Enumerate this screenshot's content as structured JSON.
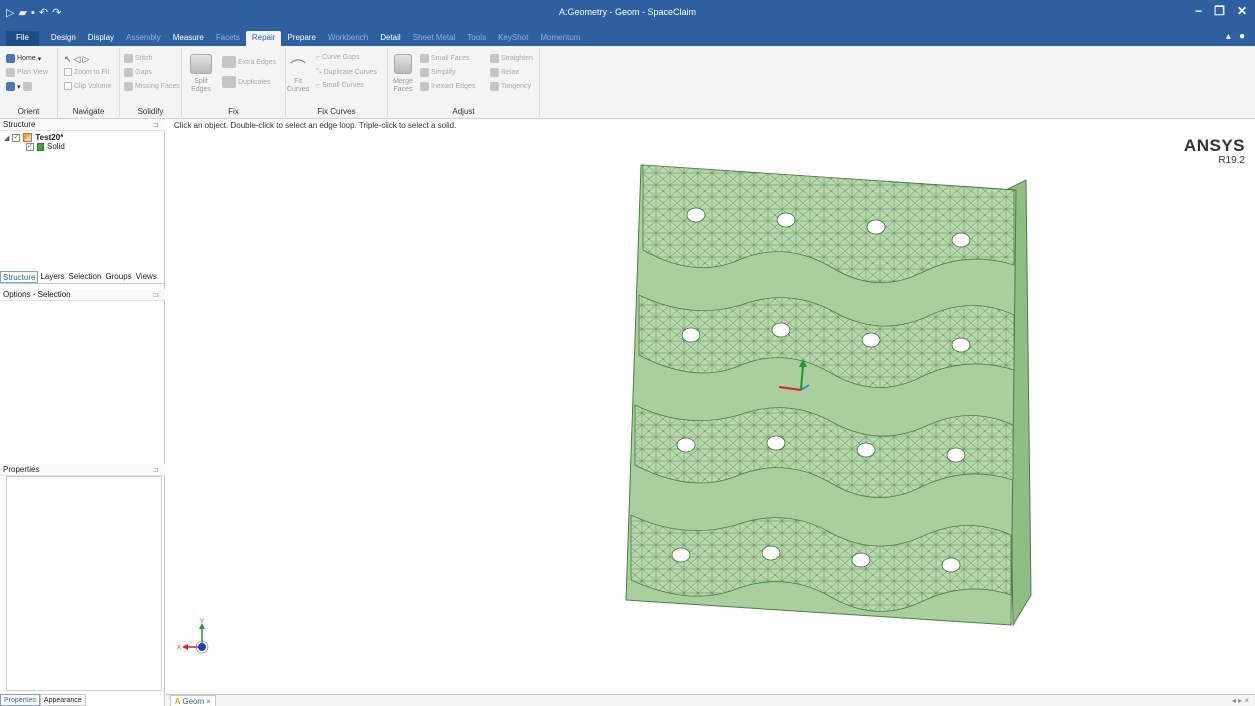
{
  "titlebar": {
    "title": "A:Geometry - Geom - SpaceClaim",
    "quick_access_icons": [
      "play-icon",
      "open-folder-icon",
      "save-icon",
      "undo-icon",
      "redo-icon"
    ],
    "window_controls": [
      "−",
      "❐",
      "✕"
    ]
  },
  "tabs": [
    {
      "label": "File",
      "style": "file"
    },
    {
      "label": "Design",
      "style": "normal"
    },
    {
      "label": "Display",
      "style": "normal"
    },
    {
      "label": "Assembly",
      "style": "dim"
    },
    {
      "label": "Measure",
      "style": "normal"
    },
    {
      "label": "Facets",
      "style": "dim"
    },
    {
      "label": "Repair",
      "style": "active"
    },
    {
      "label": "Prepare",
      "style": "normal"
    },
    {
      "label": "Workbench",
      "style": "dim"
    },
    {
      "label": "Detail",
      "style": "normal"
    },
    {
      "label": "Sheet Metal",
      "style": "dim"
    },
    {
      "label": "Tools",
      "style": "dim"
    },
    {
      "label": "KeyShot",
      "style": "dim"
    },
    {
      "label": "Momentum",
      "style": "dim"
    }
  ],
  "ribbon": {
    "orient": {
      "label": "Orient",
      "home": "Home",
      "plan_view": "Plan View"
    },
    "navigate": {
      "label": "Navigate",
      "zoom_to_fit": "Zoom to Fit",
      "clip_volume": "Clip Volume"
    },
    "solidify": {
      "label": "Solidify",
      "stitch": "Stitch",
      "gaps": "Gaps",
      "missing_faces": "Missing Faces"
    },
    "fix": {
      "label": "Fix",
      "split_edges": "Split Edges",
      "extra_edges": "Extra Edges",
      "duplicates": "Duplicates"
    },
    "fix_curves": {
      "label": "Fix Curves",
      "fit_curves": "Fit Curves",
      "curve_gaps": "Curve Gaps",
      "duplicate_curves": "Duplicate Curves",
      "small_curves": "Small Curves"
    },
    "adjust": {
      "label": "Adjust",
      "merge_faces": "Merge Faces",
      "small_faces": "Small Faces",
      "simplify": "Simplify",
      "inexact_edges": "Inexact Edges",
      "straighten": "Straighten",
      "relax": "Relax",
      "tangency": "Tangency"
    }
  },
  "structure": {
    "header": "Structure",
    "root": "Test20*",
    "child": "Solid"
  },
  "panel_tabs": [
    "Structure",
    "Layers",
    "Selection",
    "Groups",
    "Views"
  ],
  "options_header": "Options - Selection",
  "properties_header": "Properties",
  "properties_tabs": [
    "Properties",
    "Appearance"
  ],
  "viewport": {
    "hint": "Click an object. Double-click to select an edge loop. Triple-click to select a solid.",
    "brand": "ANSYS",
    "version": "R19.2",
    "triad_x": "X",
    "triad_y": "Y"
  },
  "doc_tab": "Geom",
  "colors": {
    "titlebar": "#2e5f9e",
    "model_face": "#a9cf9e",
    "model_edge": "#4d7a44"
  }
}
